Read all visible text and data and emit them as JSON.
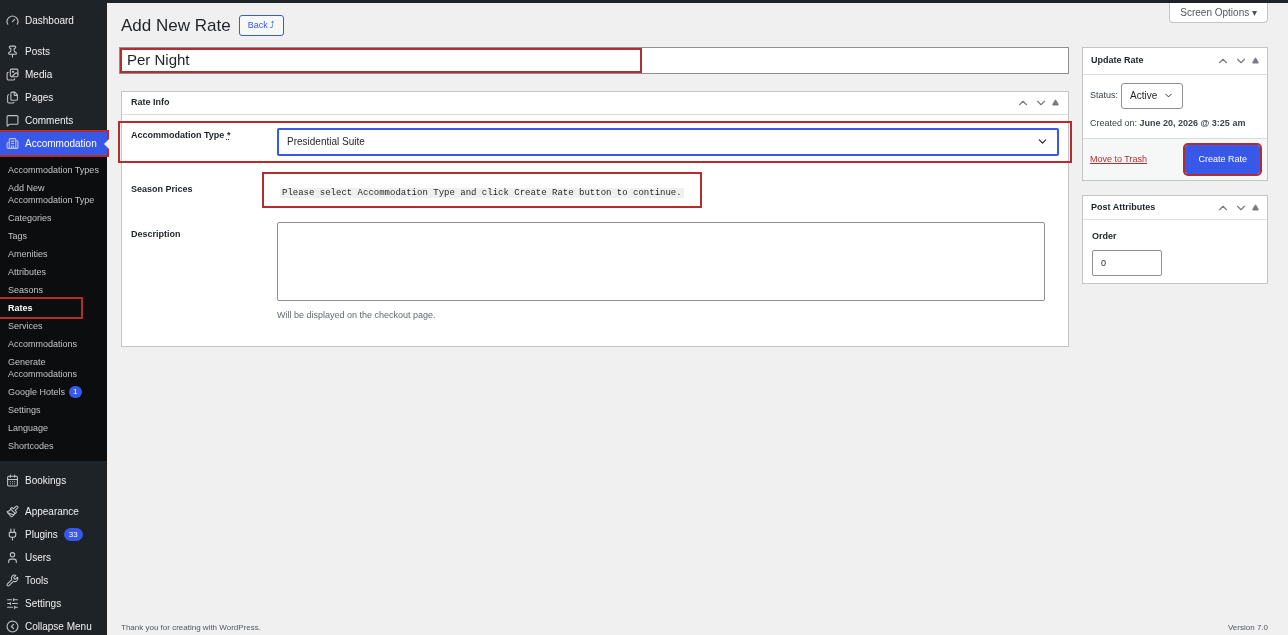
{
  "sidebar": {
    "items": [
      {
        "label": "Dashboard",
        "selected": false,
        "highlighted": false
      },
      {
        "label": "Posts",
        "selected": false,
        "highlighted": false
      },
      {
        "label": "Media",
        "selected": false,
        "highlighted": false
      },
      {
        "label": "Pages",
        "selected": false,
        "highlighted": false
      },
      {
        "label": "Comments",
        "selected": false,
        "highlighted": false
      },
      {
        "label": "Accommodation",
        "selected": true,
        "highlighted": true,
        "children": [
          {
            "label": "Accommodation Types",
            "selected": false,
            "highlighted": false
          },
          {
            "label": "Add New Accommodation Type",
            "selected": false,
            "highlighted": false
          },
          {
            "label": "Categories",
            "selected": false,
            "highlighted": false
          },
          {
            "label": "Tags",
            "selected": false,
            "highlighted": false
          },
          {
            "label": "Amenities",
            "selected": false,
            "highlighted": false
          },
          {
            "label": "Attributes",
            "selected": false,
            "highlighted": false
          },
          {
            "label": "Seasons",
            "selected": false,
            "highlighted": false
          },
          {
            "label": "Rates",
            "selected": true,
            "highlighted": true
          },
          {
            "label": "Services",
            "selected": false,
            "highlighted": false
          },
          {
            "label": "Accommodations",
            "selected": false,
            "highlighted": false
          },
          {
            "label": "Generate Accommodations",
            "selected": false,
            "highlighted": false
          },
          {
            "label": "Google Hotels",
            "badge": "1",
            "selected": false,
            "highlighted": false
          },
          {
            "label": "Settings",
            "selected": false,
            "highlighted": false
          },
          {
            "label": "Language",
            "selected": false,
            "highlighted": false
          },
          {
            "label": "Shortcodes",
            "selected": false,
            "highlighted": false
          }
        ]
      },
      {
        "label": "Bookings",
        "selected": false,
        "highlighted": false
      },
      {
        "label": "Appearance",
        "selected": false,
        "highlighted": false
      },
      {
        "label": "Plugins",
        "badge": "33",
        "selected": false,
        "highlighted": false
      },
      {
        "label": "Users",
        "selected": false,
        "highlighted": false
      },
      {
        "label": "Tools",
        "selected": false,
        "highlighted": false
      },
      {
        "label": "Settings",
        "selected": false,
        "highlighted": false
      },
      {
        "label": "Collapse Menu",
        "selected": false,
        "highlighted": false
      }
    ]
  },
  "header": {
    "title": "Add New Rate",
    "back_button": "Back ⤴",
    "screen_options": "Screen Options ▾"
  },
  "title_field": {
    "value": "Per Night",
    "highlighted": true
  },
  "rate_info": {
    "title": "Rate Info",
    "accommodation_type": {
      "label": "Accommodation Type",
      "required_mark": "*",
      "value": "Presidential Suite",
      "highlighted": true
    },
    "season_prices": {
      "label": "Season Prices",
      "notice": "Please select Accommodation Type and click Create Rate button to continue.",
      "highlighted": true
    },
    "description": {
      "label": "Description",
      "hint": "Will be displayed on the checkout page."
    }
  },
  "update_rate": {
    "title": "Update Rate",
    "status_label": "Status:",
    "status_value": "Active",
    "created_label": "Created on:",
    "created_value": "June 20, 2026 @ 3:25 am",
    "trash_link": "Move to Trash",
    "create_button": "Create Rate",
    "create_highlighted": true
  },
  "post_attributes": {
    "title": "Post Attributes",
    "order_label": "Order",
    "order_value": "0"
  },
  "footer": {
    "thanks": "Thank you for creating with WordPress.",
    "version": "Version 7.0"
  }
}
